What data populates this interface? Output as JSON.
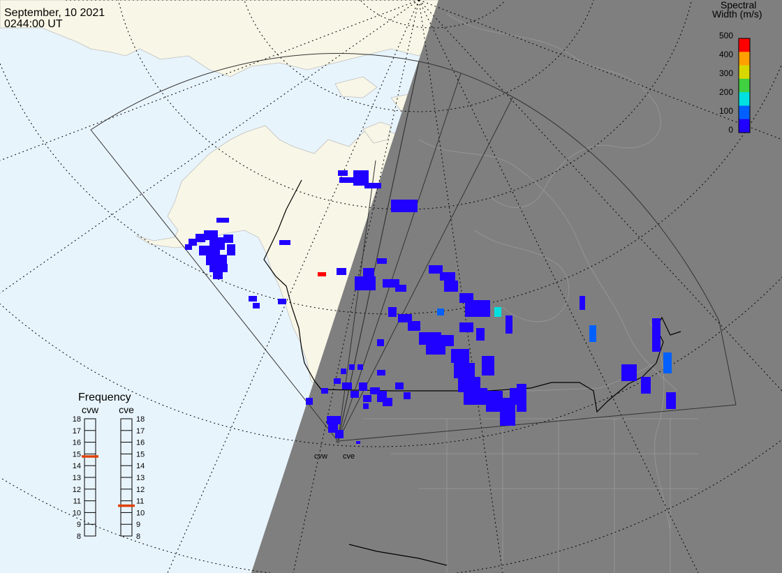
{
  "header": {
    "date": "September, 10 2021",
    "time": "0244:00 UT"
  },
  "colorbar": {
    "title_line1": "Spectral",
    "title_line2": "Width (m/s)",
    "ticks": [
      "500",
      "400",
      "300",
      "200",
      "100",
      "0"
    ],
    "colors": [
      "#ff0000",
      "#ffa000",
      "#d8d800",
      "#40d040",
      "#00e0e0",
      "#0060ff",
      "#2000ff"
    ]
  },
  "frequency_panel": {
    "title": "Frequency",
    "radars": [
      {
        "code": "cvw",
        "value_mhz": 14.8
      },
      {
        "code": "cve",
        "value_mhz": 10.6
      }
    ],
    "scale": [
      "18",
      "17",
      "16",
      "15",
      "14",
      "13",
      "12",
      "11",
      "10",
      "9",
      "8"
    ],
    "marker_color": "#e04000"
  },
  "sites": {
    "west_label": "cvw",
    "east_label": "cve"
  },
  "colors": {
    "ocean": "#e8f4fc",
    "land": "#f8f6e6",
    "night": "#7f7f7f",
    "echo_low": "#2000ff"
  }
}
